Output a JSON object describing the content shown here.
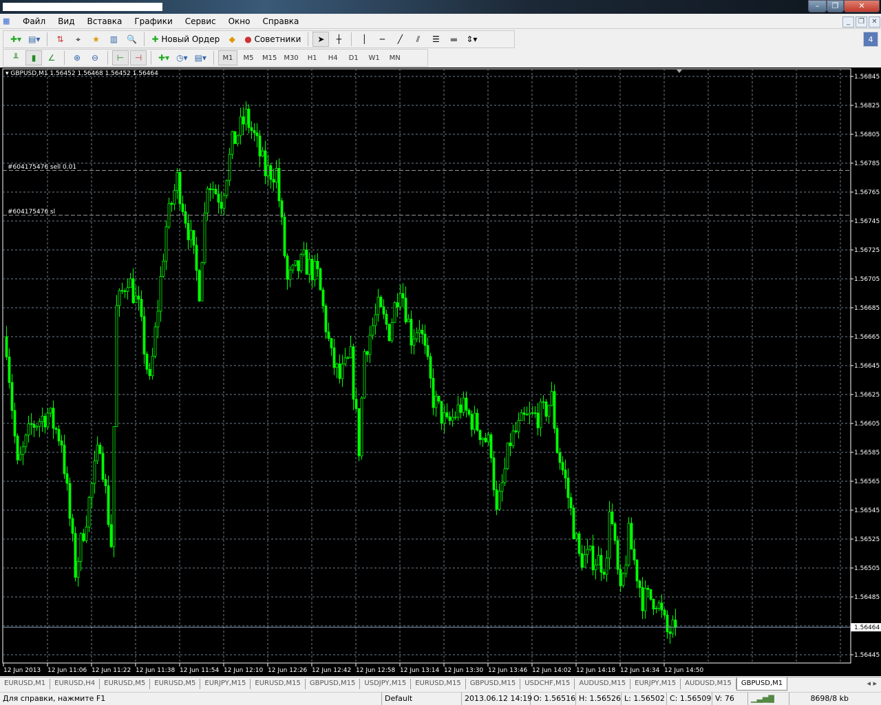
{
  "window": {
    "minimize": "–",
    "restore": "❐",
    "close": "✕"
  },
  "menu": [
    "Файл",
    "Вид",
    "Вставка",
    "Графики",
    "Сервис",
    "Окно",
    "Справка"
  ],
  "toolbar": {
    "new_order": "Новый Ордер",
    "experts": "Советники",
    "notifications": "4"
  },
  "timeframes": [
    "M1",
    "M5",
    "M15",
    "M30",
    "H1",
    "H4",
    "D1",
    "W1",
    "MN"
  ],
  "chart": {
    "header": "GBPUSD,M1  1.56452 1.56468 1.56452 1.56464",
    "order_line": "#604175476 sell 0.01",
    "sl_line": "#604175476 sl",
    "order_price": 1.5678,
    "sl_price": 1.56749,
    "bid": "1.56464",
    "colors": {
      "bg": "#000000",
      "candle": "#00ff00",
      "grid": "#708090"
    }
  },
  "chart_data": {
    "type": "candlestick",
    "symbol": "GBPUSD",
    "timeframe": "M1",
    "ylim": [
      1.56436,
      1.56852
    ],
    "price_ticks": [
      "1.56845",
      "1.56825",
      "1.56805",
      "1.56785",
      "1.56765",
      "1.56745",
      "1.56725",
      "1.56705",
      "1.56685",
      "1.56665",
      "1.56645",
      "1.56625",
      "1.56605",
      "1.56585",
      "1.56565",
      "1.56545",
      "1.56525",
      "1.56505",
      "1.56485",
      "1.56445"
    ],
    "time_ticks": [
      "12 Jun 2013",
      "12 Jun 11:06",
      "12 Jun 11:22",
      "12 Jun 11:38",
      "12 Jun 11:54",
      "12 Jun 12:10",
      "12 Jun 12:26",
      "12 Jun 12:42",
      "12 Jun 12:58",
      "12 Jun 13:14",
      "12 Jun 13:30",
      "12 Jun 13:46",
      "12 Jun 14:02",
      "12 Jun 14:18",
      "12 Jun 14:34",
      "12 Jun 14:50"
    ],
    "close_path": [
      [
        0,
        1.5666
      ],
      [
        4,
        1.56574
      ],
      [
        9,
        1.56603
      ],
      [
        15,
        1.56612
      ],
      [
        20,
        1.56593
      ],
      [
        25,
        1.56503
      ],
      [
        29,
        1.56541
      ],
      [
        34,
        1.56593
      ],
      [
        38,
        1.56522
      ],
      [
        40,
        1.56684
      ],
      [
        44,
        1.56707
      ],
      [
        48,
        1.56684
      ],
      [
        52,
        1.56631
      ],
      [
        58,
        1.56741
      ],
      [
        62,
        1.56774
      ],
      [
        67,
        1.56731
      ],
      [
        70,
        1.56698
      ],
      [
        73,
        1.56774
      ],
      [
        78,
        1.5676
      ],
      [
        82,
        1.56798
      ],
      [
        87,
        1.56817
      ],
      [
        90,
        1.56803
      ],
      [
        94,
        1.56779
      ],
      [
        98,
        1.56779
      ],
      [
        102,
        1.56703
      ],
      [
        108,
        1.56717
      ],
      [
        113,
        1.56707
      ],
      [
        118,
        1.5665
      ],
      [
        121,
        1.56636
      ],
      [
        125,
        1.5665
      ],
      [
        128,
        1.56588
      ],
      [
        130,
        1.56655
      ],
      [
        135,
        1.56684
      ],
      [
        139,
        1.56669
      ],
      [
        143,
        1.56703
      ],
      [
        147,
        1.56665
      ],
      [
        150,
        1.56674
      ],
      [
        155,
        1.56622
      ],
      [
        160,
        1.56603
      ],
      [
        165,
        1.56617
      ],
      [
        171,
        1.56603
      ],
      [
        176,
        1.56588
      ],
      [
        178,
        1.56541
      ],
      [
        183,
        1.56593
      ],
      [
        188,
        1.56607
      ],
      [
        195,
        1.56612
      ],
      [
        198,
        1.56622
      ],
      [
        200,
        1.56588
      ],
      [
        203,
        1.56565
      ],
      [
        208,
        1.56512
      ],
      [
        213,
        1.56512
      ],
      [
        218,
        1.56507
      ],
      [
        219,
        1.5655
      ],
      [
        223,
        1.56484
      ],
      [
        226,
        1.56527
      ],
      [
        231,
        1.56484
      ],
      [
        236,
        1.56484
      ],
      [
        240,
        1.5646
      ],
      [
        243,
        1.56464
      ]
    ]
  },
  "tabs": [
    "EURUSD,M1",
    "EURUSD,H4",
    "EURUSD,M5",
    "EURUSD,M5",
    "EURJPY,M15",
    "EURUSD,M15",
    "GBPUSD,M15",
    "USDJPY,M15",
    "EURUSD,M15",
    "GBPUSD,M15",
    "USDCHF,M15",
    "AUDUSD,M15",
    "EURJPY,M15",
    "AUDUSD,M15",
    "GBPUSD,M1"
  ],
  "status": {
    "help": "Для справки, нажмите F1",
    "profile": "Default",
    "time": "2013.06.12 14:19",
    "open": "O: 1.56516",
    "high": "H: 1.56526",
    "low": "L: 1.56502",
    "close": "C: 1.56509",
    "volume": "V: 76",
    "traffic": "8698/8 kb"
  }
}
